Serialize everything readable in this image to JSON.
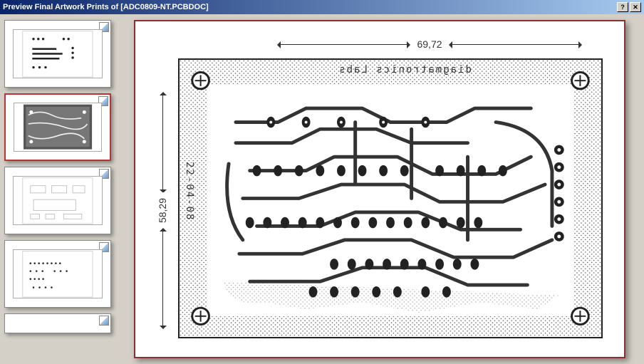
{
  "window": {
    "title": "Preview Final Artwork Prints of [ADC0809-NT.PCBDOC]"
  },
  "thumbnails": {
    "count": 5,
    "selected_index": 1
  },
  "preview": {
    "dimension_width": "69,72",
    "dimension_height": "58,29",
    "board_label": "diagmatronics Labs",
    "board_date": "22-04-08"
  }
}
